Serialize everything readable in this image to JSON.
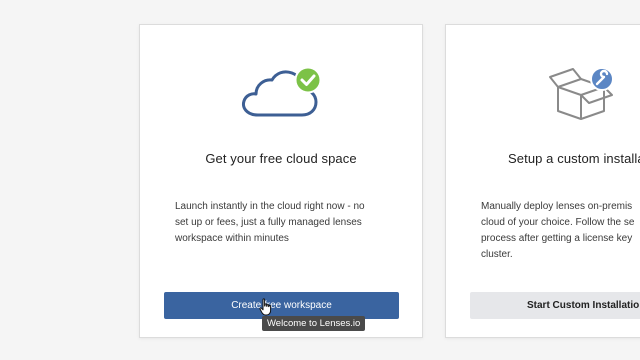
{
  "cards": [
    {
      "title": "Get your free cloud space",
      "description_lines": [
        "Launch instantly in the cloud right now - no",
        "set up or fees, just a fully managed lenses",
        "workspace within minutes"
      ],
      "button_label": "Create free workspace",
      "icon": "cloud-check-icon"
    },
    {
      "title": "Setup a custom installa",
      "description_lines": [
        "Manually deploy lenses on-premis",
        "cloud of your choice. Follow the se",
        "process after getting a license key",
        "cluster."
      ],
      "button_label": "Start Custom Installatio",
      "icon": "box-wrench-icon"
    }
  ],
  "tooltip": "Welcome to Lenses.io",
  "colors": {
    "primary_button": "#3a64a0",
    "secondary_button": "#e6e7ea",
    "cloud_stroke": "#3d5f94",
    "check_badge": "#7cc247",
    "wrench_badge": "#5b86c4",
    "box_stroke": "#8a8a8a"
  }
}
